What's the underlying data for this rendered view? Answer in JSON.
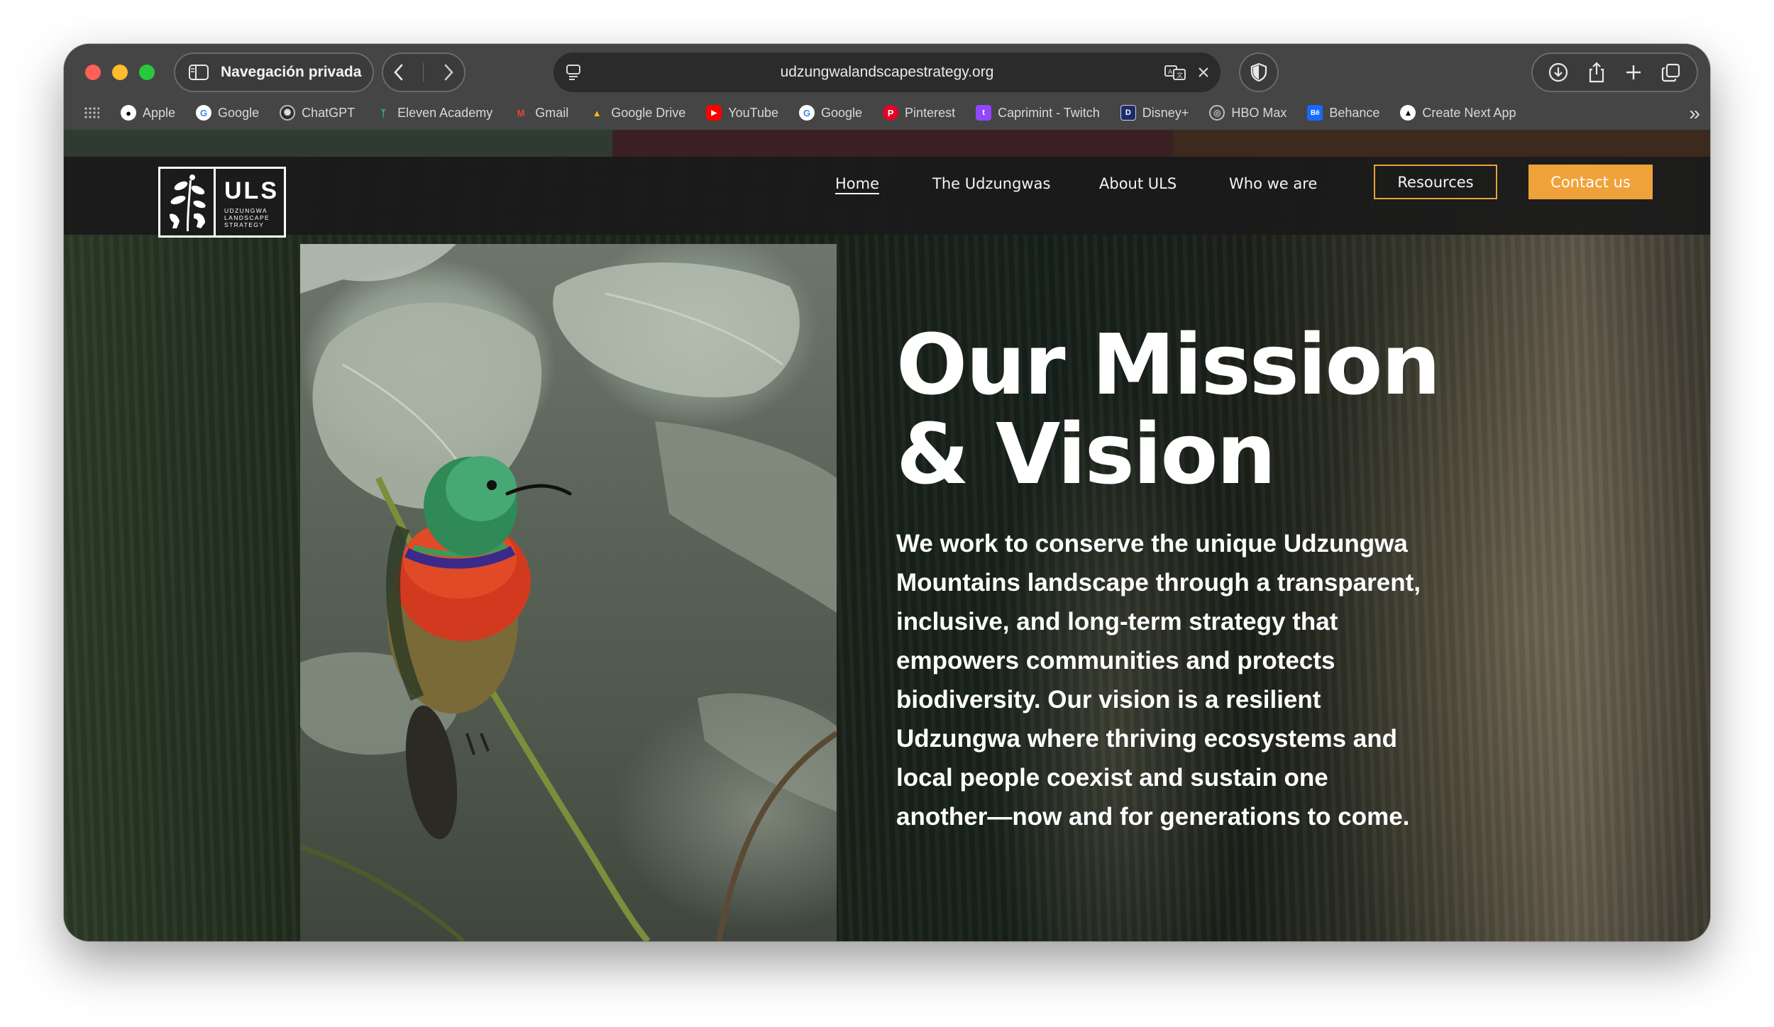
{
  "browser": {
    "private_label": "Navegación privada",
    "url": "udzungwalandscapestrategy.org",
    "bookmarks": [
      {
        "label": "Apple",
        "icon": "apple-icon",
        "color": "#ffffff"
      },
      {
        "label": "Google",
        "icon": "google-icon",
        "color": "#4285f4"
      },
      {
        "label": "ChatGPT",
        "icon": "chatgpt-icon",
        "color": "#8e8e8e"
      },
      {
        "label": "Eleven Academy",
        "icon": "eleven-academy-icon",
        "color": "#3cb9a4"
      },
      {
        "label": "Gmail",
        "icon": "gmail-icon",
        "color": "#ea4335"
      },
      {
        "label": "Google Drive",
        "icon": "google-drive-icon",
        "color": "#fbbc04"
      },
      {
        "label": "YouTube",
        "icon": "youtube-icon",
        "color": "#ff0000"
      },
      {
        "label": "Google",
        "icon": "google-icon",
        "color": "#4285f4"
      },
      {
        "label": "Pinterest",
        "icon": "pinterest-icon",
        "color": "#e60023"
      },
      {
        "label": "Caprimint - Twitch",
        "icon": "twitch-icon",
        "color": "#9146ff"
      },
      {
        "label": "Disney+",
        "icon": "disney-plus-icon",
        "color": "#1c2c6b"
      },
      {
        "label": "HBO Max",
        "icon": "globe-icon",
        "color": "#8e8e8e"
      },
      {
        "label": "Behance",
        "icon": "behance-icon",
        "color": "#1769ff"
      },
      {
        "label": "Create Next App",
        "icon": "nextjs-icon",
        "color": "#000000"
      }
    ]
  },
  "site": {
    "logo": {
      "abbr": "ULS",
      "line1": "UDZUNGWA",
      "line2": "LANDSCAPE",
      "line3": "STRATEGY"
    },
    "nav": {
      "home": "Home",
      "udzungwas": "The Udzungwas",
      "about": "About ULS",
      "who": "Who we are",
      "resources": "Resources",
      "contact": "Contact us"
    },
    "accent_color": "#f0a23a",
    "hero": {
      "title_line1": "Our Mission",
      "title_line2": "& Vision",
      "body": "We work to conserve the unique Udzungwa Mountains landscape through a transparent, inclusive, and long-term strategy that empowers communities and protects biodiversity. Our vision is a resilient Udzungwa where thriving ecosystems and local people coexist and sustain one another—now and for generations to come."
    }
  }
}
